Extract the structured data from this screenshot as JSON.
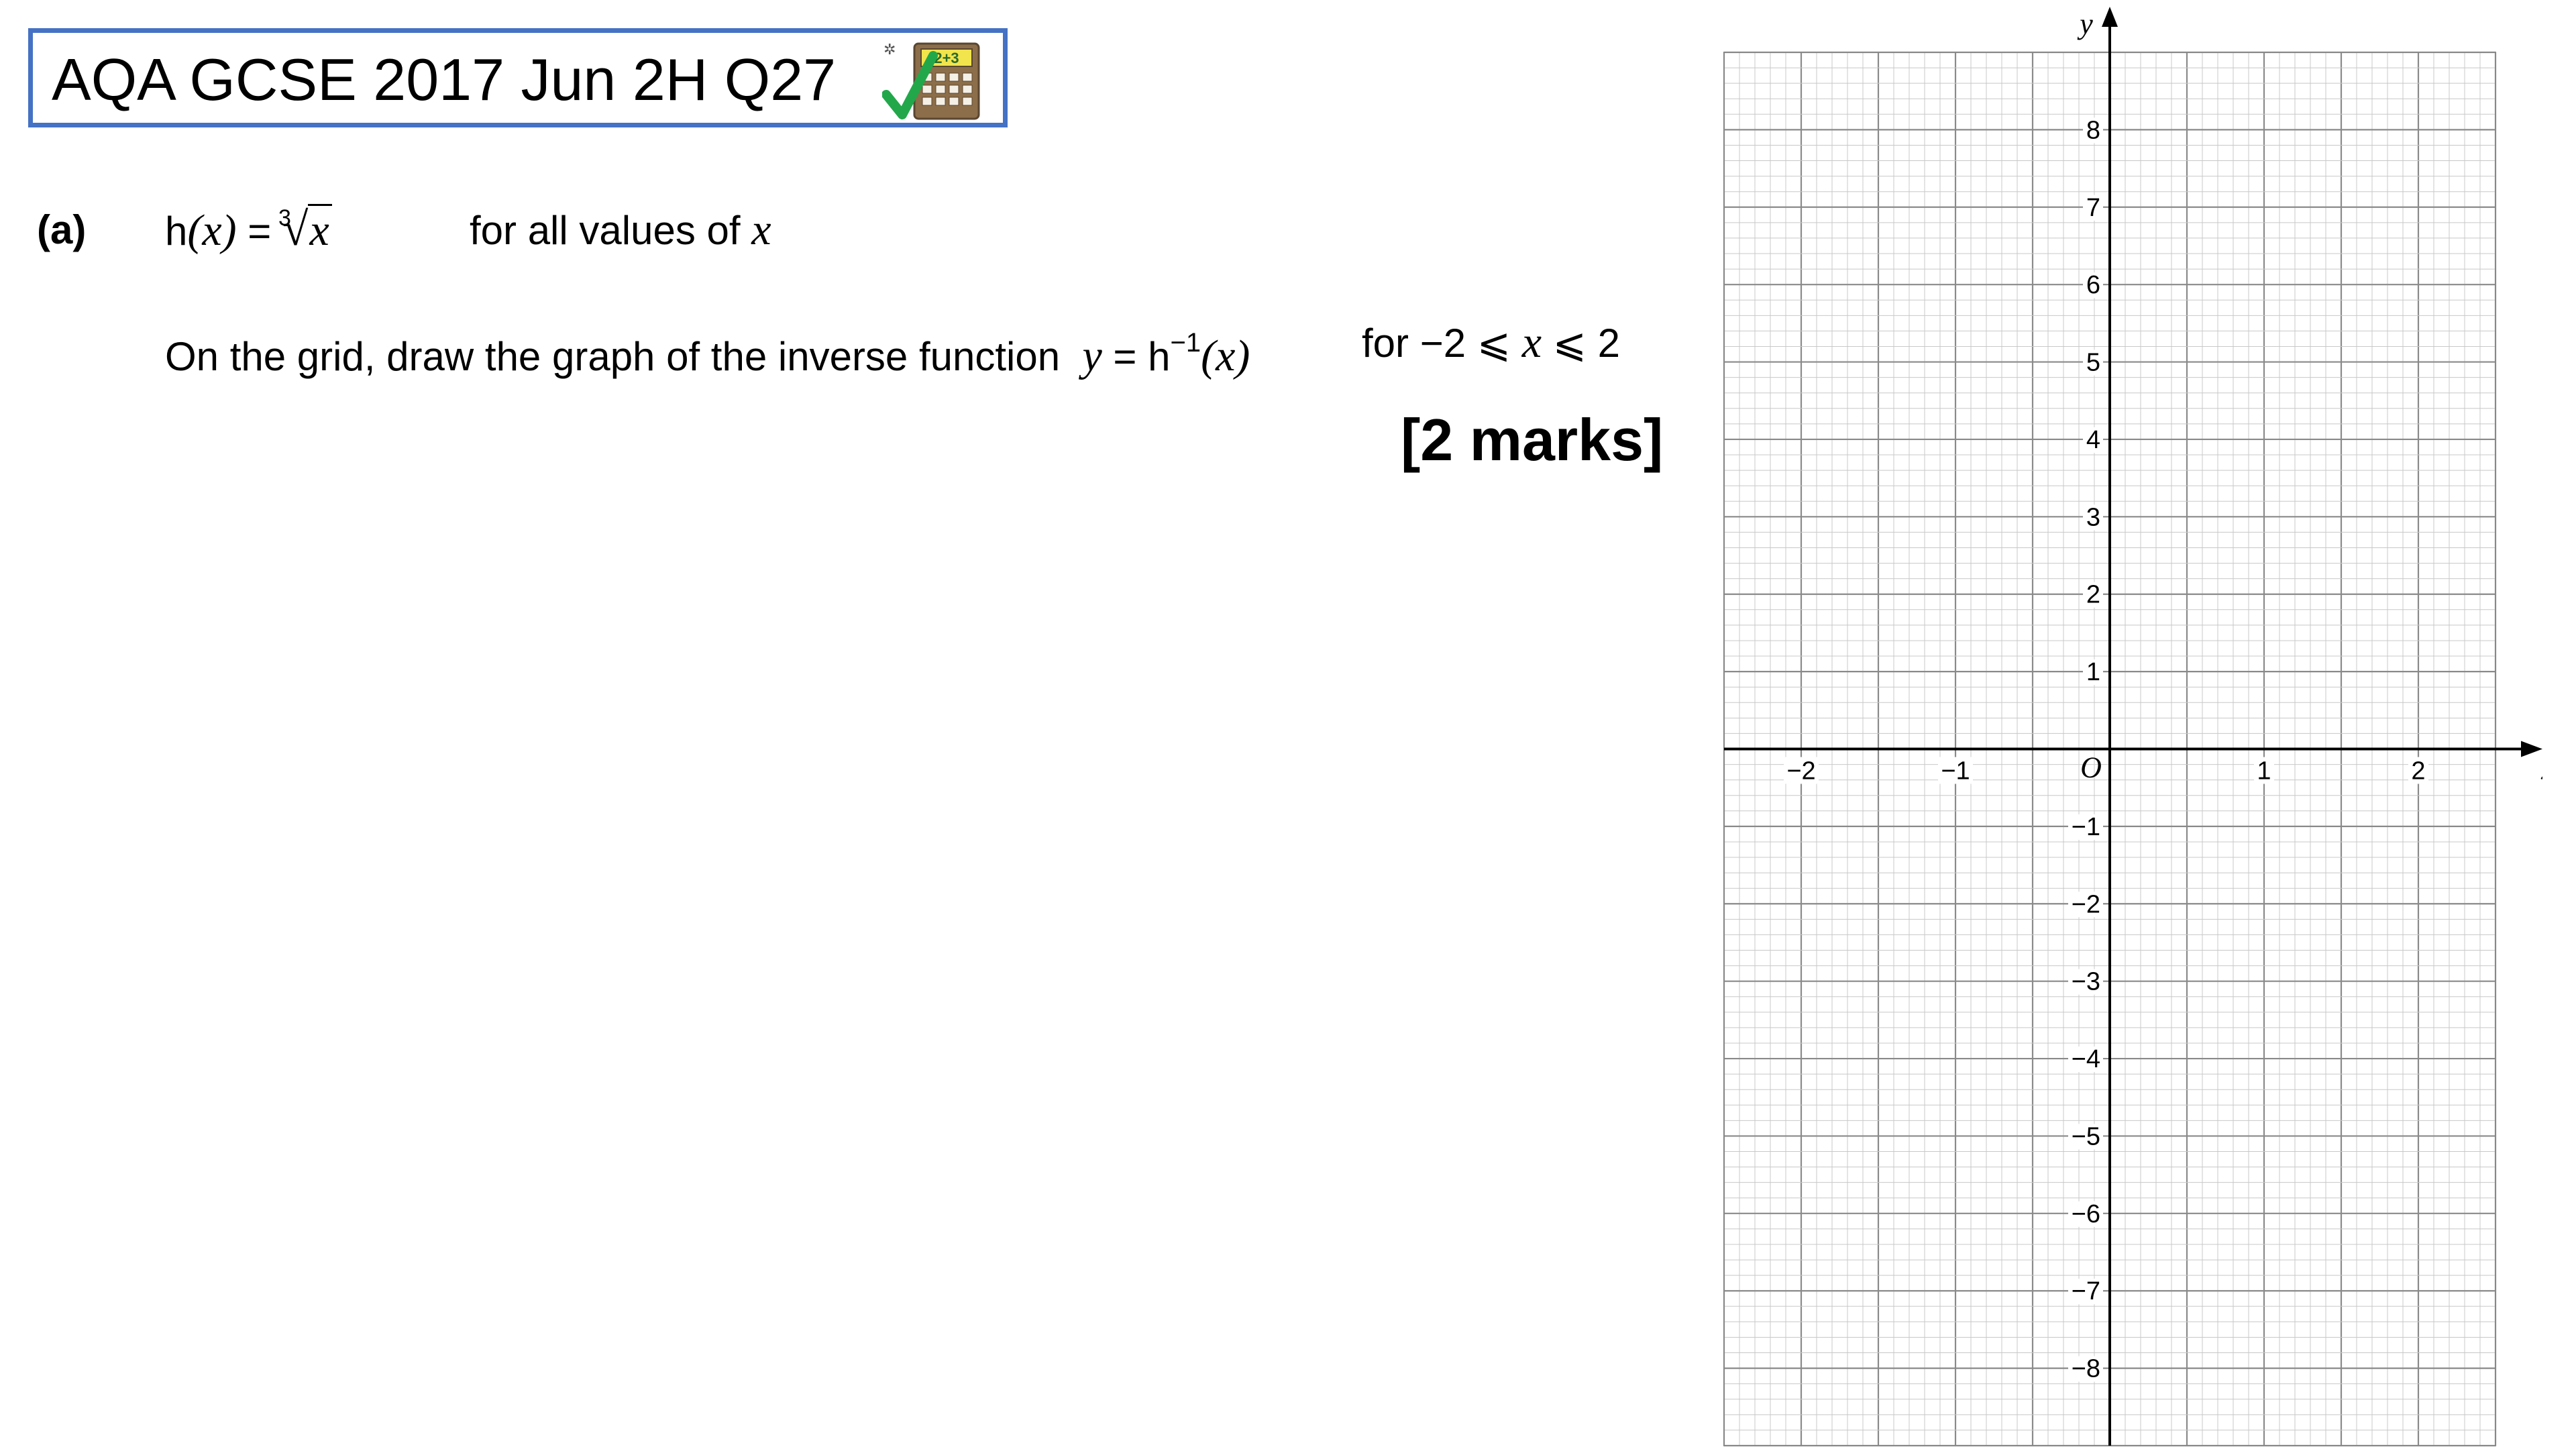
{
  "title": "AQA GCSE 2017 Jun 2H Q27",
  "calculator_icon": {
    "name": "calculator-allowed-icon",
    "display_text": "2+3",
    "colors": {
      "body": "#8c6e4a",
      "screen": "#f2e44c",
      "check": "#22a84a",
      "border": "#4472c4"
    }
  },
  "question": {
    "part_label": "(a)",
    "function_name": "h",
    "function_arg": "(x)",
    "equals": " = ",
    "root_index": "3",
    "radicand": "x",
    "domain_text": "for all values of",
    "domain_var": "x",
    "instruction": "On the grid, draw the graph of the inverse function",
    "inverse_lhs": "y",
    "inverse_eq": " = h",
    "inverse_sup": "−1",
    "inverse_arg": "(x)",
    "range_prefix": "for  −2 ⩽ ",
    "range_var": "x",
    "range_suffix": " ⩽ 2",
    "marks": "[2 marks]"
  },
  "chart_data": {
    "type": "grid",
    "x_axis": {
      "label": "x",
      "range": [
        -2.5,
        2.5
      ],
      "ticks": [
        -2,
        -1,
        1,
        2
      ],
      "tick_labels": [
        "−2",
        "−1",
        "1",
        "2"
      ]
    },
    "y_axis": {
      "label": "y",
      "range": [
        -9,
        9
      ],
      "ticks": [
        8,
        7,
        6,
        5,
        4,
        3,
        2,
        1,
        -1,
        -2,
        -3,
        -4,
        -5,
        -6,
        -7,
        -8
      ],
      "tick_labels": [
        "8",
        "7",
        "6",
        "5",
        "4",
        "3",
        "2",
        "1",
        "−1",
        "−2",
        "−3",
        "−4",
        "−5",
        "−6",
        "−7",
        "−8"
      ]
    },
    "origin_label": "O",
    "minor_divisions_x": 10,
    "minor_divisions_y": 5,
    "grid": true,
    "series": []
  }
}
